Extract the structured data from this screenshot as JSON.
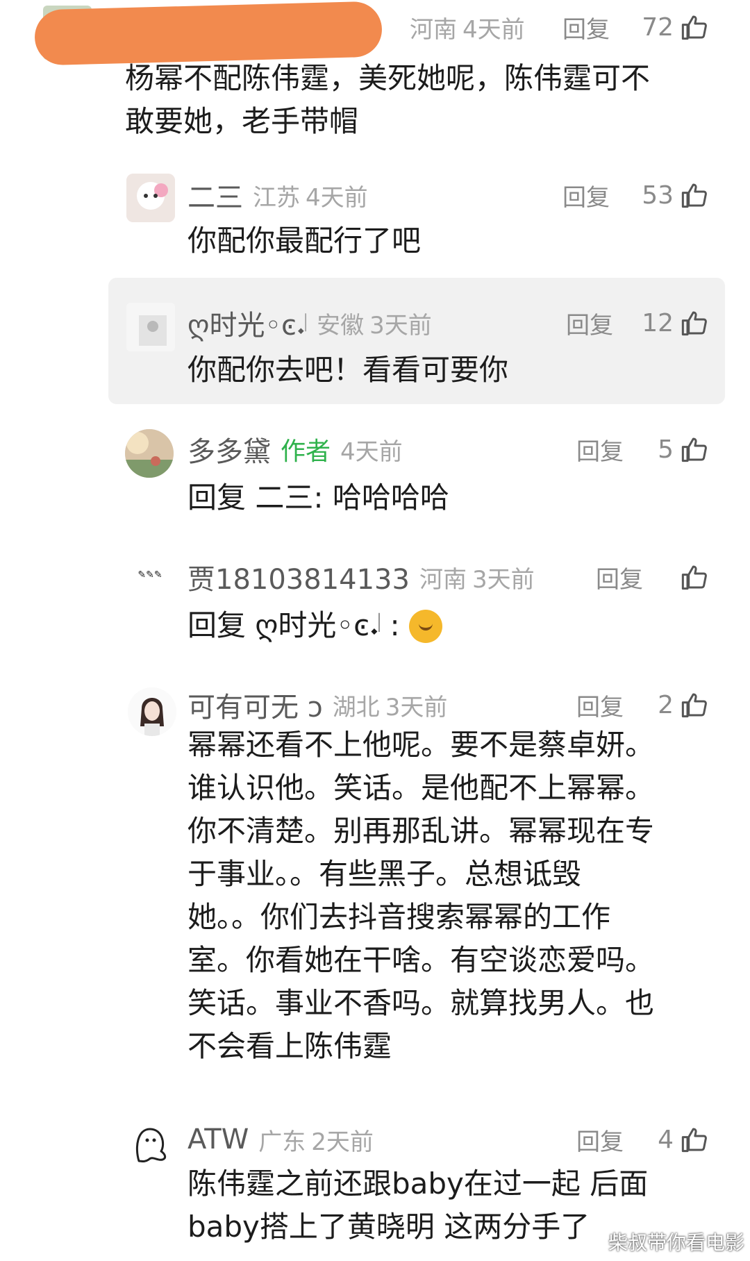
{
  "comments": [
    {
      "username": "",
      "location": "河南",
      "time": "4天前",
      "reply": "回复",
      "likes": "72",
      "text_lines": [
        "杨幂不配陈伟霆，美死她呢，陈伟霆可不",
        "敢要她，老手带帽"
      ]
    },
    {
      "username": "二三",
      "location": "江苏",
      "time": "4天前",
      "reply": "回复",
      "likes": "53",
      "text_lines": [
        "你配你最配行了吧"
      ]
    },
    {
      "username": "ღ时光◦ͼ𝆺𝅥",
      "location": "安徽",
      "time": "3天前",
      "reply": "回复",
      "likes": "12",
      "text_lines": [
        "你配你去吧！看看可要你"
      ]
    },
    {
      "username": "多多黛",
      "author_tag": "作者",
      "location": "",
      "time": "4天前",
      "reply": "回复",
      "likes": "5",
      "text_lines": [
        "回复 二三: 哈哈哈哈"
      ]
    },
    {
      "username": "贾18103814133",
      "location": "河南",
      "time": "3天前",
      "reply": "回复",
      "likes": "",
      "text_prefix": "回复 ღ时光◦ͼ𝆺𝅥 :"
    },
    {
      "username": "可有可无 ͻ",
      "location": "湖北",
      "time": "3天前",
      "reply": "回复",
      "likes": "2",
      "text_lines": [
        "幂幂还看不上他呢。要不是蔡卓妍。",
        "谁认识他。笑话。是他配不上幂幂。",
        "你不清楚。别再那乱讲。幂幂现在专",
        "于事业。。有些黑子。总想诋毁",
        "她。。你们去抖音搜索幂幂的工作",
        "室。你看她在干啥。有空谈恋爱吗。",
        "笑话。事业不香吗。就算找男人。也",
        "不会看上陈伟霆"
      ]
    },
    {
      "username": "ATW",
      "location": "广东",
      "time": "2天前",
      "reply": "回复",
      "likes": "4",
      "text_lines": [
        "陈伟霆之前还跟baby在过一起 后面",
        "baby搭上了黄晓明 这两分手了"
      ]
    }
  ],
  "watermark": "柴叔带你看电影",
  "colors": {
    "author_tag": "#2fb24c",
    "highlight_bg": "#f1f1f1",
    "censor_mark": "#f28a4e"
  },
  "icons": {
    "like": "thumbs-up-icon",
    "emoji": "thinking-face-emoji"
  }
}
